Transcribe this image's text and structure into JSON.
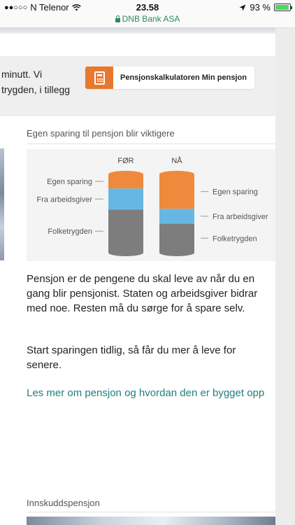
{
  "status_bar": {
    "signal_dots": "●●○○○",
    "carrier": "N Telenor",
    "time": "23.58",
    "battery_percent": "93 %",
    "battery_level": 0.93,
    "url": "DNB Bank ASA"
  },
  "info_box": {
    "text_line1": "minutt. Vi",
    "text_line2": "trygden, i tillegg",
    "calculator_button": "Pensjonskalkulatoren Min pensjon"
  },
  "section_pension": {
    "title": "Egen sparing til pensjon blir viktigere"
  },
  "chart_data": {
    "type": "bar",
    "stacked": true,
    "categories": [
      "FØR",
      "NÅ"
    ],
    "series": [
      {
        "name": "Folketrygden",
        "values": [
          0.55,
          0.37
        ],
        "color": "#7d7d7d"
      },
      {
        "name": "Fra arbeidsgiver",
        "values": [
          0.27,
          0.19
        ],
        "color": "#67b7e3"
      },
      {
        "name": "Egen sparing",
        "values": [
          0.18,
          0.44
        ],
        "color": "#ef8a3c"
      }
    ],
    "left_labels": [
      "Egen sparing",
      "Fra arbeidsgiver",
      "Folketrygden"
    ],
    "right_labels": [
      "Egen sparing",
      "Fra arbeidsgiver",
      "Folketrygden"
    ]
  },
  "body": {
    "paragraph1": "Pensjon er de pengene du skal leve av når du en gang blir pensjonist. Staten og arbeidsgiver bidrar med noe. Resten må du sørge for å spare selv.",
    "paragraph2": "Start sparingen tidlig, så får du mer å leve for senere.",
    "link": "Les mer om pensjon og hvordan den er bygget opp"
  },
  "section_innskudd": {
    "title": "Innskuddspensjon"
  }
}
